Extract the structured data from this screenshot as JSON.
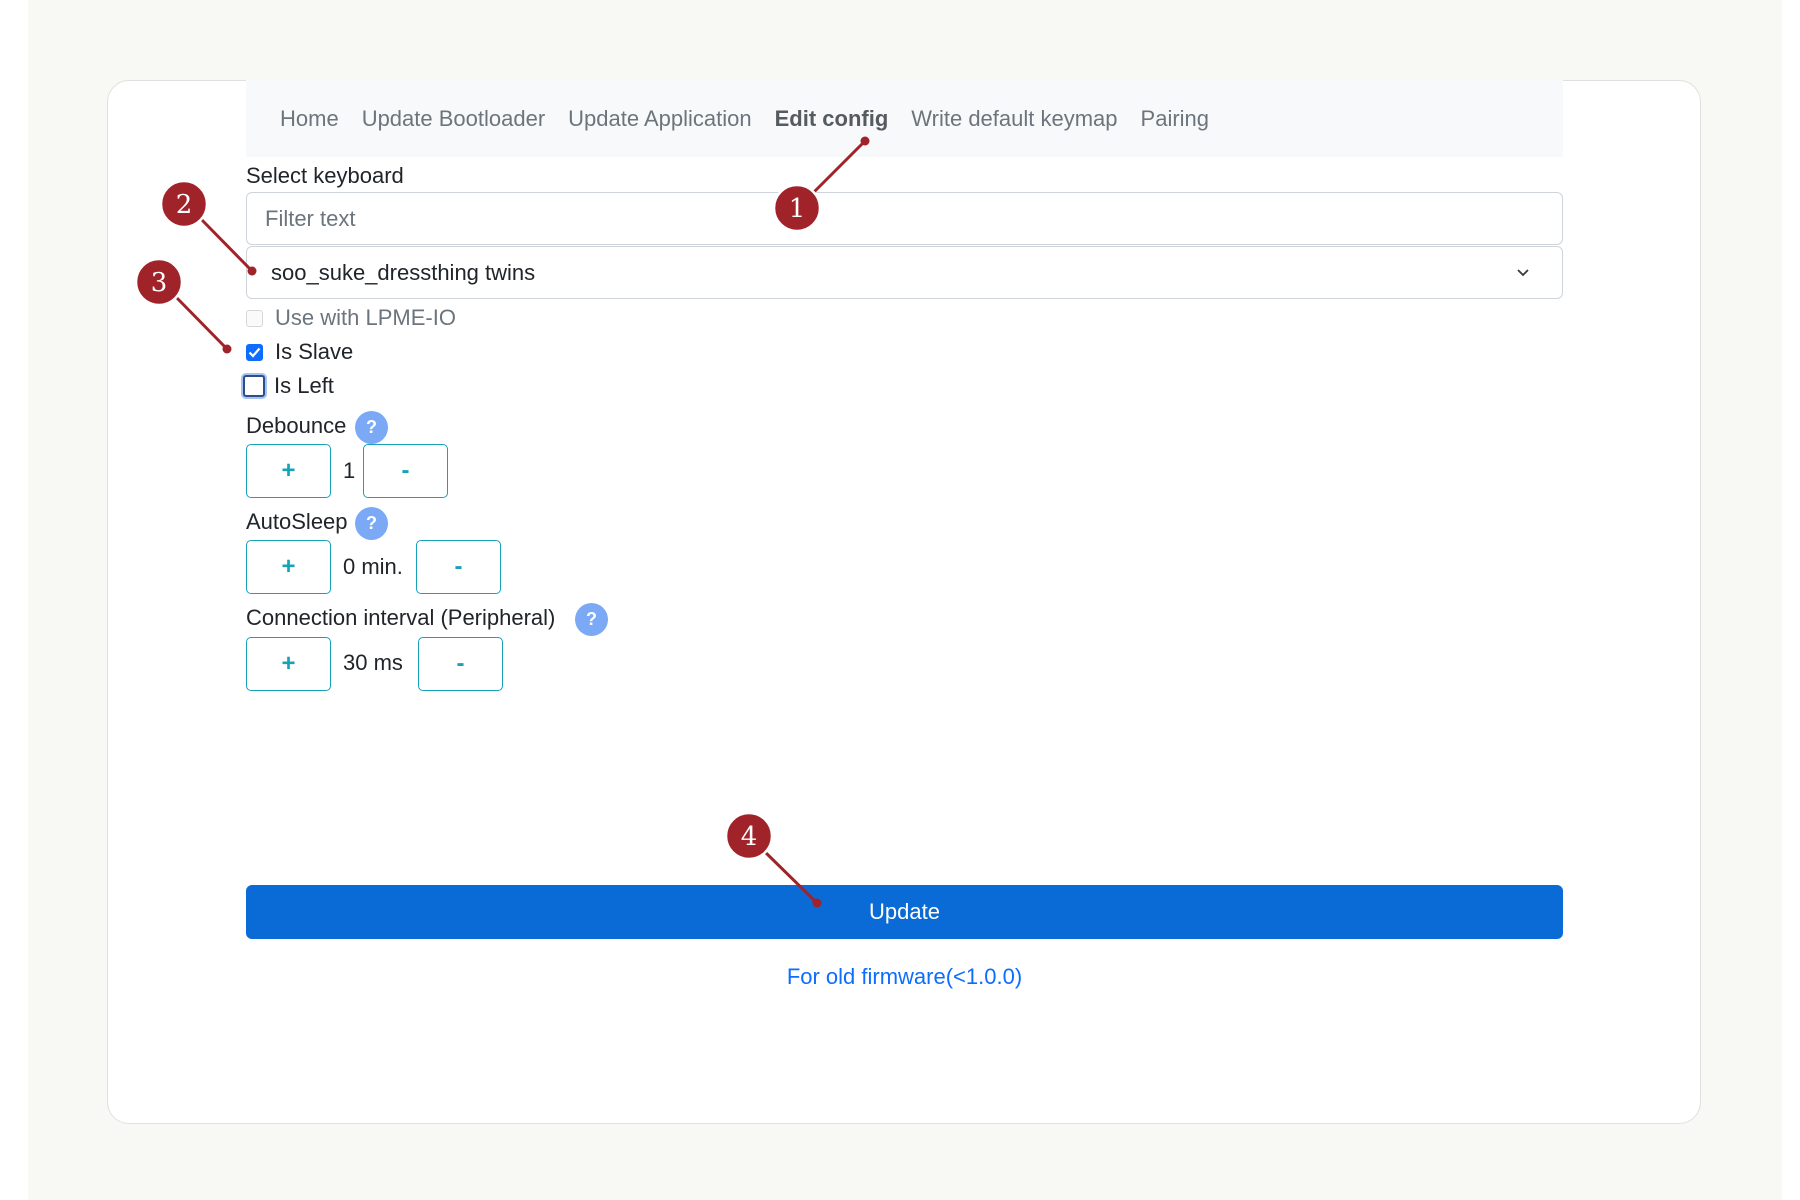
{
  "nav": {
    "items": [
      {
        "label": "Home"
      },
      {
        "label": "Update Bootloader"
      },
      {
        "label": "Update Application"
      },
      {
        "label": "Edit config",
        "active": true
      },
      {
        "label": "Write default keymap"
      },
      {
        "label": "Pairing"
      }
    ]
  },
  "keyboard": {
    "label": "Select keyboard",
    "filter_placeholder": "Filter text",
    "selected": "soo_suke_dressthing twins"
  },
  "options": {
    "lpme_label": "Use with LPME-IO",
    "lpme_checked": false,
    "slave_label": "Is Slave",
    "slave_checked": true,
    "left_label": "Is Left",
    "left_checked": false
  },
  "settings": {
    "debounce": {
      "label": "Debounce",
      "value": "1",
      "plus": "+",
      "minus": "-"
    },
    "autosleep": {
      "label": "AutoSleep",
      "value": "0 min.",
      "plus": "+",
      "minus": "-"
    },
    "interval": {
      "label": "Connection interval (Peripheral)",
      "value": "30 ms",
      "plus": "+",
      "minus": "-"
    },
    "help_glyph": "?"
  },
  "actions": {
    "update_label": "Update",
    "old_firmware_link": "For old firmware(<1.0.0)"
  },
  "callouts": [
    "1",
    "2",
    "3",
    "4"
  ],
  "colors": {
    "primary": "#0a6ad6",
    "info": "#17a2b8",
    "callout": "#a0232a",
    "help": "#7ba9f5"
  }
}
